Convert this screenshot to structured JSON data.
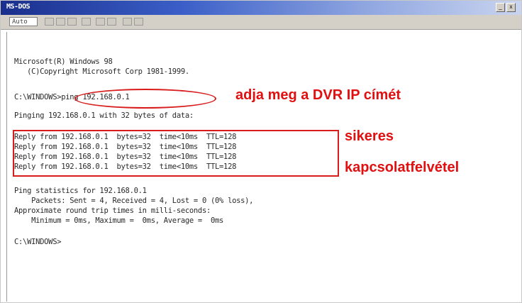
{
  "window": {
    "title": "MS-DOS",
    "controls": [
      "_",
      "x"
    ],
    "font_size": "Auto"
  },
  "console": {
    "lines": [
      "Microsoft(R) Windows 98",
      "   (C)Copyright Microsoft Corp 1981-1999.",
      "C:\\WINDOWS>ping 192.168.0.1",
      "Pinging 192.168.0.1 with 32 bytes of data:",
      "Reply from 192.168.0.1  bytes=32  time<10ms  TTL=128",
      "Reply from 192.168.0.1  bytes=32  time<10ms  TTL=128",
      "Reply from 192.168.0.1  bytes=32  time<10ms  TTL=128",
      "Reply from 192.168.0.1  bytes=32  time<10ms  TTL=128",
      "Ping statistics for 192.168.0.1",
      "    Packets: Sent = 4, Received = 4, Lost = 0 (0% loss),",
      "Approximate round trip times in milli-seconds:",
      "    Minimum = 0ms, Maximum =  0ms, Average =  0ms",
      "C:\\WINDOWS>"
    ]
  },
  "annotations": {
    "ip_note": "adja meg a DVR IP címét",
    "success_line1": "sikeres",
    "success_line2": "kapcsolatfelvétel",
    "color": "#e01010"
  }
}
